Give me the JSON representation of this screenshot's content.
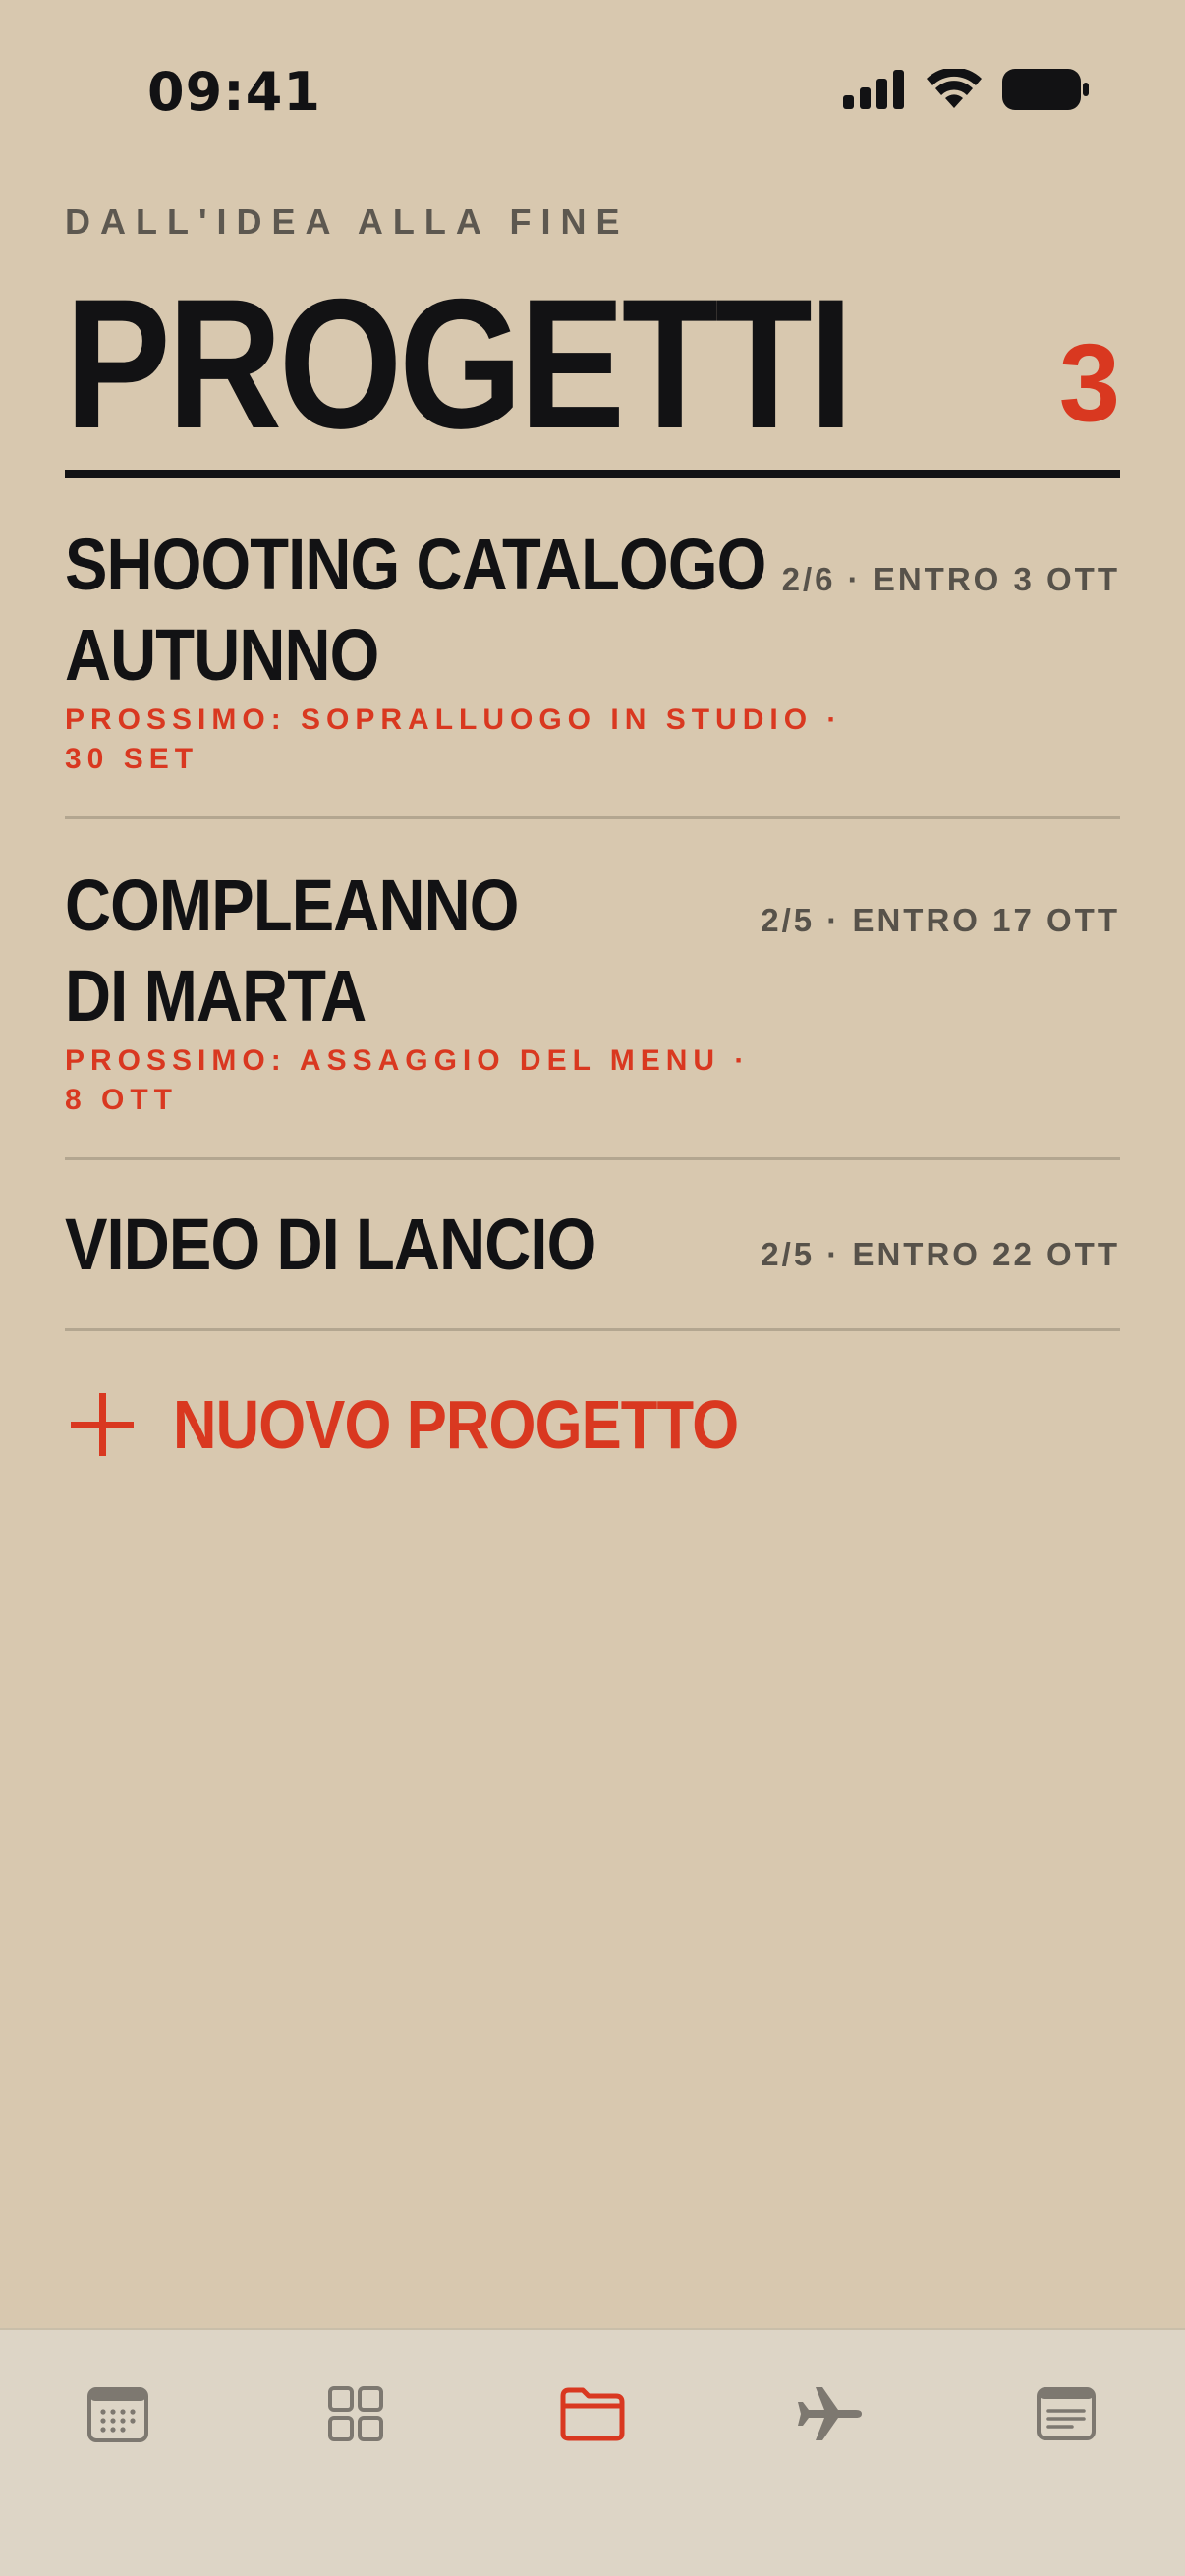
{
  "status_bar": {
    "time": "09:41"
  },
  "header": {
    "eyebrow": "DALL'IDEA ALLA FINE",
    "title": "PROGETTI",
    "count": "3"
  },
  "projects": [
    {
      "name_line1": "SHOOTING CATALOGO",
      "name_line2": "AUTUNNO",
      "meta": "2/6 · ENTRO 3 OTT",
      "next_line1": "PROSSIMO: SOPRALLUOGO IN STUDIO ·",
      "next_line2": "30 SET"
    },
    {
      "name_line1": "COMPLEANNO",
      "name_line2": "DI MARTA",
      "meta": "2/5 · ENTRO 17 OTT",
      "next_line1": "PROSSIMO: ASSAGGIO DEL MENU ·",
      "next_line2": "8 OTT"
    },
    {
      "name_line1": "VIDEO DI LANCIO",
      "meta": "2/5 · ENTRO 22 OTT"
    }
  ],
  "new_project": {
    "label": "NUOVO PROGETTO"
  },
  "tab_bar": {
    "tabs": [
      {
        "icon": "calendar-icon",
        "active": false
      },
      {
        "icon": "grid-icon",
        "active": false
      },
      {
        "icon": "folder-icon",
        "active": true
      },
      {
        "icon": "airplane-icon",
        "active": false
      },
      {
        "icon": "notes-icon",
        "active": false
      }
    ]
  },
  "colors": {
    "background": "#d8c8af",
    "accent": "#d93820",
    "text": "#121214",
    "muted": "#57524a",
    "tab_bar": "#ddd5c6",
    "tab_inactive": "#7d7870"
  }
}
